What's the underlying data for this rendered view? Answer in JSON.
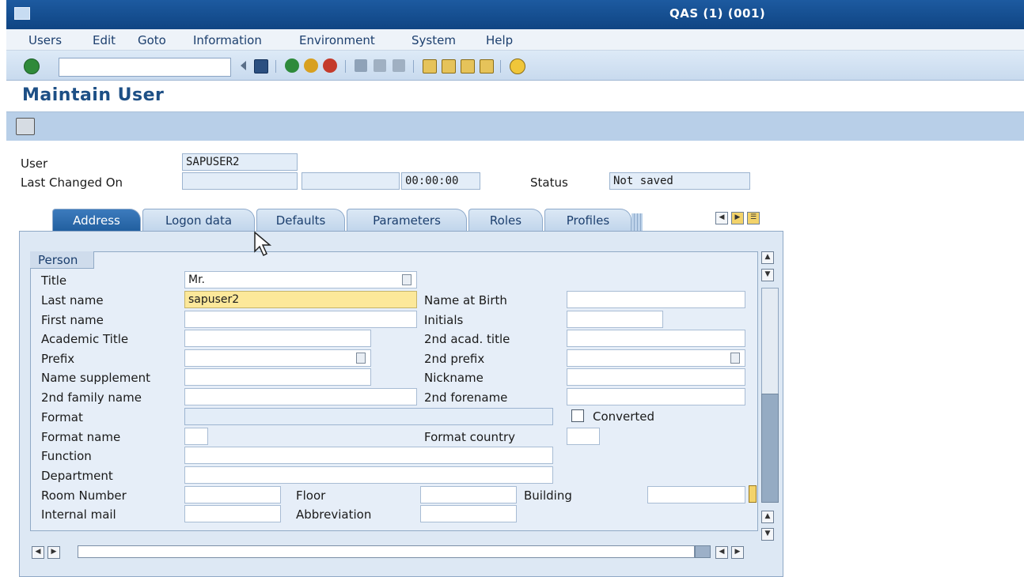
{
  "window": {
    "title": "QAS (1) (001)"
  },
  "menu": [
    "Users",
    "Edit",
    "Goto",
    "Information",
    "Environment",
    "System",
    "Help"
  ],
  "toolbar": {
    "command_field_value": ""
  },
  "page": {
    "title": "Maintain User"
  },
  "header": {
    "user_label": "User",
    "user_value": "SAPUSER2",
    "last_changed_label": "Last Changed On",
    "last_changed_by": "",
    "last_changed_date": "",
    "last_changed_time": "00:00:00",
    "status_label": "Status",
    "status_value": "Not saved"
  },
  "tabs": [
    "Address",
    "Logon data",
    "Defaults",
    "Parameters",
    "Roles",
    "Profiles"
  ],
  "active_tab": "Address",
  "person": {
    "group_title": "Person",
    "title_label": "Title",
    "title_value": "Mr.",
    "last_name_label": "Last name",
    "last_name_value": "sapuser2",
    "name_at_birth_label": "Name at Birth",
    "first_name_label": "First name",
    "initials_label": "Initials",
    "academic_title_label": "Academic Title",
    "second_acad_title_label": "2nd acad. title",
    "prefix_label": "Prefix",
    "second_prefix_label": "2nd prefix",
    "name_supplement_label": "Name supplement",
    "nickname_label": "Nickname",
    "second_family_name_label": "2nd family name",
    "second_forename_label": "2nd forename",
    "format_label": "Format",
    "converted_label": "Converted",
    "format_name_label": "Format name",
    "format_country_label": "Format country",
    "function_label": "Function",
    "department_label": "Department",
    "room_number_label": "Room Number",
    "floor_label": "Floor",
    "building_label": "Building",
    "internal_mail_label": "Internal mail",
    "abbreviation_label": "Abbreviation"
  },
  "icons": [
    "enter-icon",
    "save-icon",
    "back-icon",
    "exit-icon",
    "cancel-icon",
    "print-icon",
    "find-icon",
    "find-next-icon",
    "first-page-icon",
    "previous-page-icon",
    "next-page-icon",
    "last-page-icon",
    "help-icon"
  ]
}
